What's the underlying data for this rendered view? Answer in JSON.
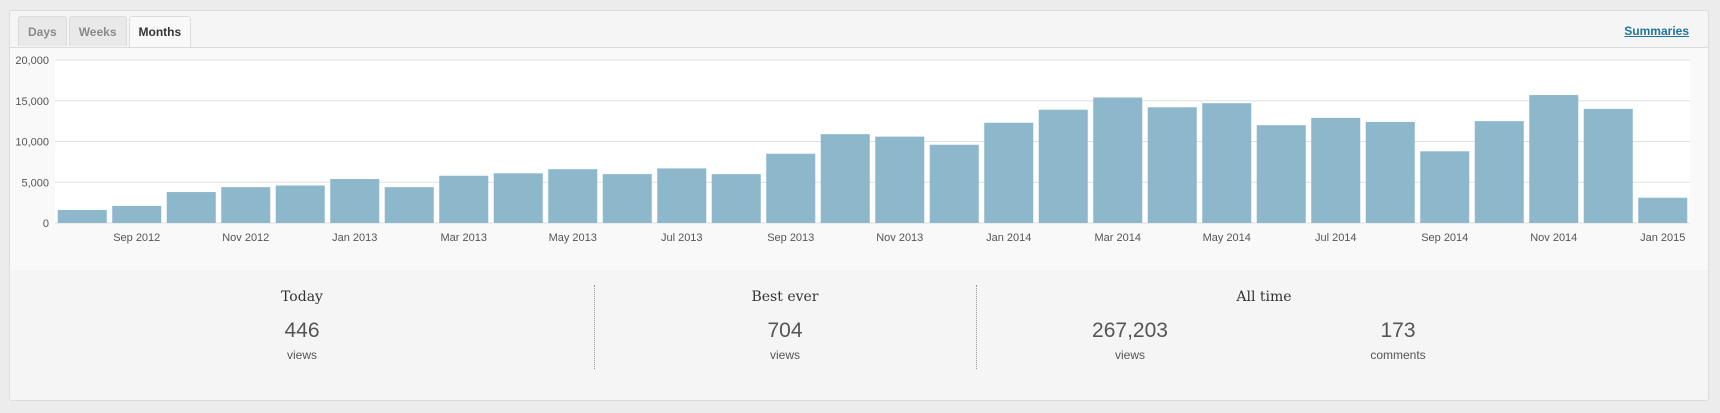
{
  "tabs": [
    {
      "label": "Days",
      "active": false
    },
    {
      "label": "Weeks",
      "active": false
    },
    {
      "label": "Months",
      "active": true
    }
  ],
  "summaries_link": "Summaries",
  "colors": {
    "bar": "#8db8cc",
    "grid": "#e0e0e0",
    "link": "#21759b"
  },
  "chart_data": {
    "type": "bar",
    "title": "",
    "xlabel": "",
    "ylabel": "",
    "ylim": [
      0,
      20000
    ],
    "yticks": [
      0,
      5000,
      10000,
      15000,
      20000
    ],
    "ytick_labels": [
      "0",
      "5,000",
      "10,000",
      "15,000",
      "20,000"
    ],
    "grid": true,
    "categories": [
      "Aug 2012",
      "Sep 2012",
      "Oct 2012",
      "Nov 2012",
      "Dec 2012",
      "Jan 2013",
      "Feb 2013",
      "Mar 2013",
      "Apr 2013",
      "May 2013",
      "Jun 2013",
      "Jul 2013",
      "Aug 2013",
      "Sep 2013",
      "Oct 2013",
      "Nov 2013",
      "Dec 2013",
      "Jan 2014",
      "Feb 2014",
      "Mar 2014",
      "Apr 2014",
      "May 2014",
      "Jun 2014",
      "Jul 2014",
      "Aug 2014",
      "Sep 2014",
      "Oct 2014",
      "Nov 2014",
      "Dec 2014",
      "Jan 2015"
    ],
    "xtick_labels": [
      "Sep 2012",
      "Nov 2012",
      "Jan 2013",
      "Mar 2013",
      "May 2013",
      "Jul 2013",
      "Sep 2013",
      "Nov 2013",
      "Jan 2014",
      "Mar 2014",
      "May 2014",
      "Jul 2014",
      "Sep 2014",
      "Nov 2014",
      "Jan 2015"
    ],
    "values": [
      1600,
      2100,
      3800,
      4400,
      4600,
      5400,
      4400,
      5800,
      6100,
      6600,
      6000,
      6700,
      6000,
      8500,
      10900,
      10600,
      9600,
      12300,
      13900,
      15400,
      14200,
      14700,
      12000,
      12900,
      12400,
      8800,
      12500,
      15700,
      14000,
      3100
    ]
  },
  "stats": {
    "today": {
      "heading": "Today",
      "value": "446",
      "label": "views"
    },
    "best": {
      "heading": "Best ever",
      "value": "704",
      "label": "views"
    },
    "alltime": {
      "heading": "All time",
      "views_value": "267,203",
      "views_label": "views",
      "comments_value": "173",
      "comments_label": "comments"
    }
  }
}
